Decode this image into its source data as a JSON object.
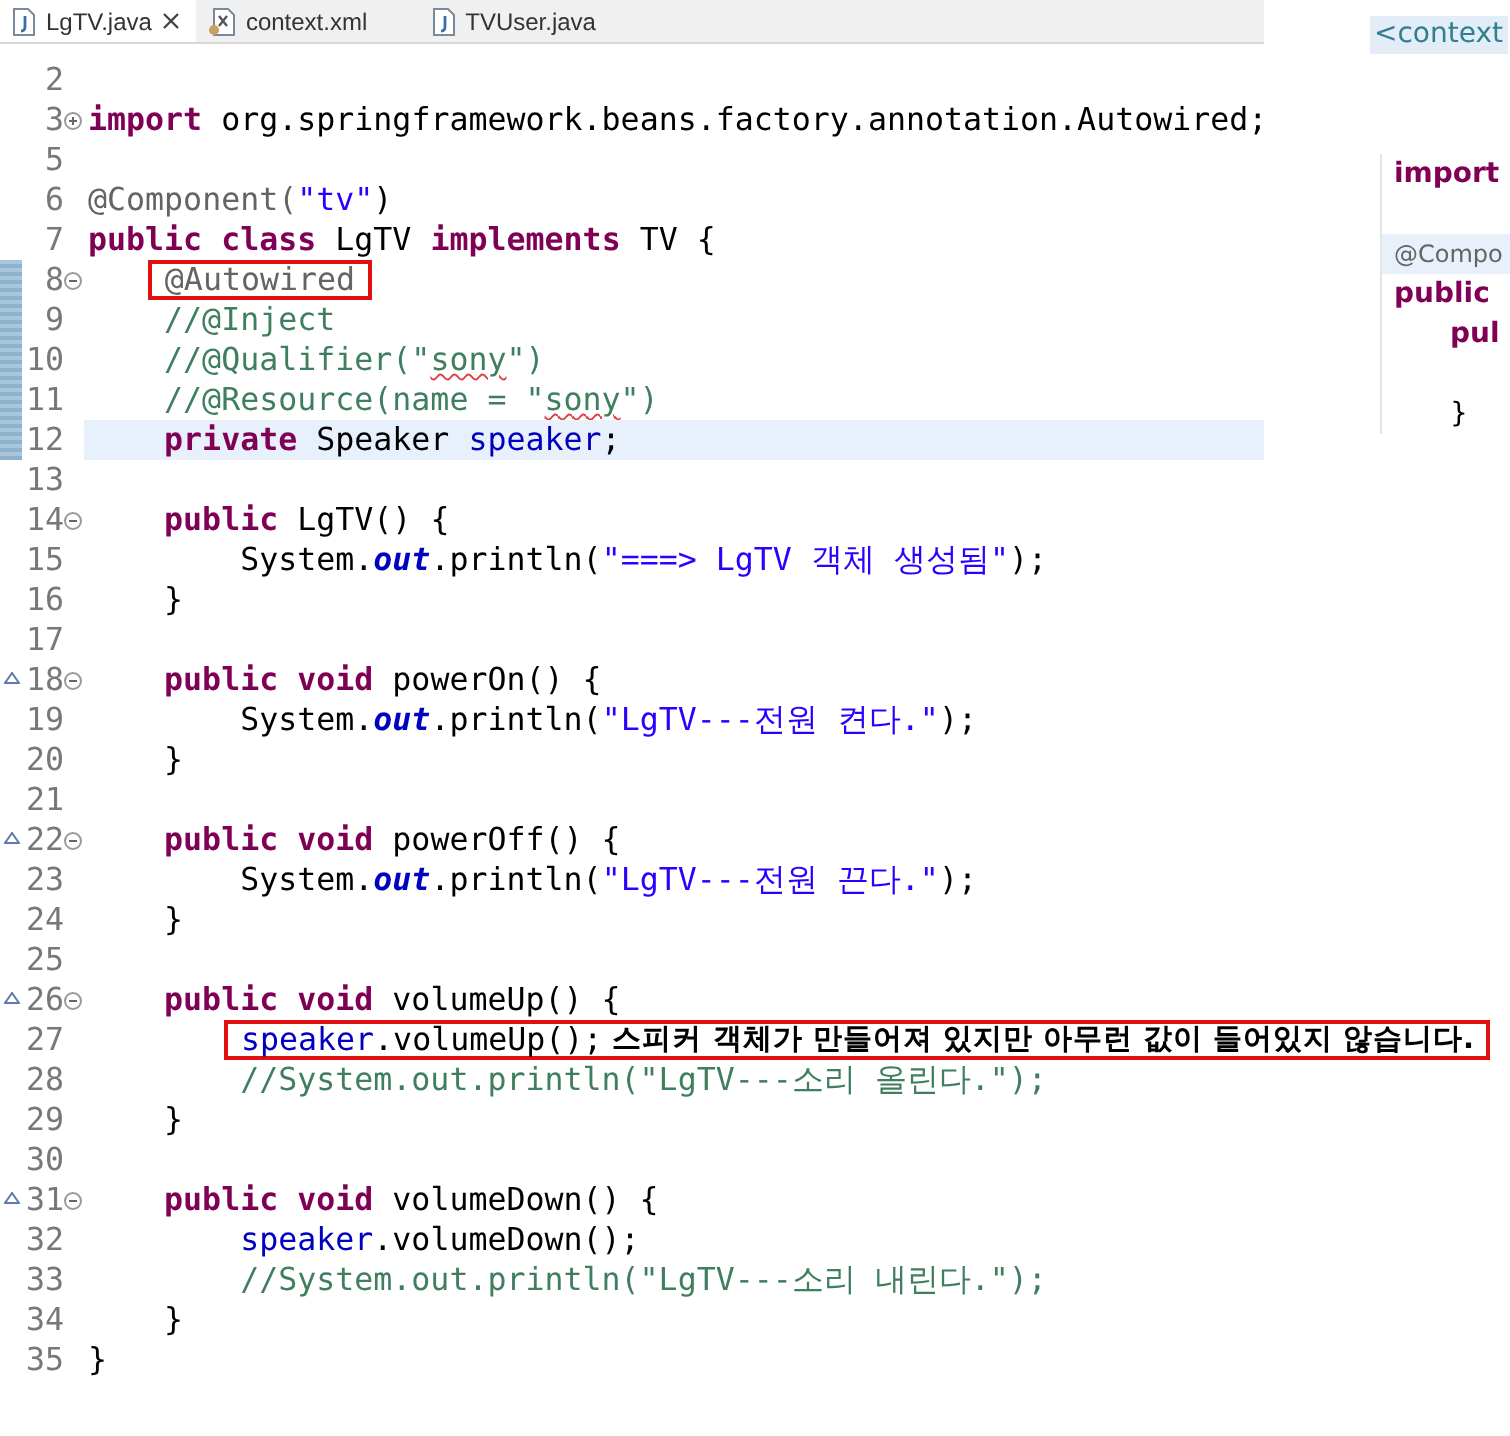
{
  "tabs": [
    {
      "label": "LgTV.java",
      "kind": "java",
      "selected": true
    },
    {
      "label": "context.xml",
      "kind": "xml",
      "selected": false
    },
    {
      "label": "TVUser.java",
      "kind": "java",
      "selected": false
    }
  ],
  "lines": [
    {
      "number": "2"
    },
    {
      "number": "3",
      "folded": true,
      "tokens": [
        {
          "kind": "keyword",
          "text": "import"
        },
        {
          "kind": "plain",
          "text": " org.springframework.beans.factory.annotation.Autowired;"
        }
      ]
    },
    {
      "number": "5"
    },
    {
      "number": "6",
      "tokens": [
        {
          "kind": "annotation",
          "text": "@Component("
        },
        {
          "kind": "string",
          "text": "\"tv\""
        },
        {
          "kind": "plain",
          "text": ")"
        }
      ]
    },
    {
      "number": "7",
      "tokens": [
        {
          "kind": "keyword",
          "text": "public class"
        },
        {
          "kind": "plain",
          "text": " LgTV "
        },
        {
          "kind": "keyword",
          "text": "implements"
        },
        {
          "kind": "plain",
          "text": " TV {"
        }
      ],
      "children": [
        {
          "number": "8",
          "folded": false,
          "changed": true,
          "boxed": true,
          "tokens": [
            {
              "kind": "annotation",
              "text": "@Autowired"
            }
          ]
        },
        {
          "number": "9",
          "changed": true,
          "tokens": [
            {
              "kind": "comment",
              "text": "//@Inject"
            }
          ]
        },
        {
          "number": "10",
          "changed": true,
          "tokens": [
            {
              "kind": "comment",
              "text": "//@Qualifier(\""
            },
            {
              "kind": "comment",
              "text": "sony",
              "misspelled": true
            },
            {
              "kind": "comment",
              "text": "\")"
            }
          ]
        },
        {
          "number": "11",
          "changed": true,
          "tokens": [
            {
              "kind": "comment",
              "text": "//@Resource(name = \""
            },
            {
              "kind": "comment",
              "text": "sony",
              "misspelled": true
            },
            {
              "kind": "comment",
              "text": "\")"
            }
          ]
        },
        {
          "number": "12",
          "changed": true,
          "current": true,
          "tokens": [
            {
              "kind": "keyword",
              "text": "private"
            },
            {
              "kind": "plain",
              "text": " Speaker "
            },
            {
              "kind": "field",
              "text": "speaker"
            },
            {
              "kind": "plain",
              "text": ";"
            }
          ]
        },
        {
          "number": "13"
        },
        {
          "number": "14",
          "folded": false,
          "tokens": [
            {
              "kind": "keyword",
              "text": "public"
            },
            {
              "kind": "plain",
              "text": " LgTV() {"
            }
          ],
          "children": [
            {
              "number": "15",
              "tokens": [
                {
                  "kind": "plain",
                  "text": "System."
                },
                {
                  "kind": "static",
                  "text": "out"
                },
                {
                  "kind": "plain",
                  "text": ".println("
                },
                {
                  "kind": "string",
                  "text": "\"===> LgTV 객체 생성됨\""
                },
                {
                  "kind": "plain",
                  "text": ");"
                }
              ]
            }
          ]
        },
        {
          "number": "16",
          "tokens": [
            {
              "kind": "plain",
              "text": "}"
            }
          ]
        },
        {
          "number": "17"
        },
        {
          "number": "18",
          "folded": false,
          "override": true,
          "tokens": [
            {
              "kind": "keyword",
              "text": "public void"
            },
            {
              "kind": "plain",
              "text": " powerOn() {"
            }
          ],
          "children": [
            {
              "number": "19",
              "tokens": [
                {
                  "kind": "plain",
                  "text": "System."
                },
                {
                  "kind": "static",
                  "text": "out"
                },
                {
                  "kind": "plain",
                  "text": ".println("
                },
                {
                  "kind": "string",
                  "text": "\"LgTV---전원 켠다.\""
                },
                {
                  "kind": "plain",
                  "text": ");"
                }
              ]
            }
          ]
        },
        {
          "number": "20",
          "tokens": [
            {
              "kind": "plain",
              "text": "}"
            }
          ]
        },
        {
          "number": "21"
        },
        {
          "number": "22",
          "folded": false,
          "override": true,
          "tokens": [
            {
              "kind": "keyword",
              "text": "public void"
            },
            {
              "kind": "plain",
              "text": " powerOff() {"
            }
          ],
          "children": [
            {
              "number": "23",
              "tokens": [
                {
                  "kind": "plain",
                  "text": "System."
                },
                {
                  "kind": "static",
                  "text": "out"
                },
                {
                  "kind": "plain",
                  "text": ".println("
                },
                {
                  "kind": "string",
                  "text": "\"LgTV---전원 끈다.\""
                },
                {
                  "kind": "plain",
                  "text": ");"
                }
              ]
            }
          ]
        },
        {
          "number": "24",
          "tokens": [
            {
              "kind": "plain",
              "text": "}"
            }
          ]
        },
        {
          "number": "25"
        },
        {
          "number": "26",
          "folded": false,
          "override": true,
          "tokens": [
            {
              "kind": "keyword",
              "text": "public void"
            },
            {
              "kind": "plain",
              "text": " volumeUp() {"
            }
          ],
          "children": [
            {
              "number": "27",
              "boxed": true,
              "note": "스피커 객체가 만들어져 있지만 아무런 값이 들어있지 않습니다.",
              "tokens": [
                {
                  "kind": "field",
                  "text": "speaker"
                },
                {
                  "kind": "plain",
                  "text": ".volumeUp();"
                }
              ]
            },
            {
              "number": "28",
              "tokens": [
                {
                  "kind": "comment",
                  "text": "//System.out.println(\"LgTV---소리 올린다.\");"
                }
              ]
            }
          ]
        },
        {
          "number": "29",
          "tokens": [
            {
              "kind": "plain",
              "text": "}"
            }
          ]
        },
        {
          "number": "30"
        },
        {
          "number": "31",
          "folded": false,
          "override": true,
          "tokens": [
            {
              "kind": "keyword",
              "text": "public void"
            },
            {
              "kind": "plain",
              "text": " volumeDown() {"
            }
          ],
          "children": [
            {
              "number": "32",
              "tokens": [
                {
                  "kind": "field",
                  "text": "speaker"
                },
                {
                  "kind": "plain",
                  "text": ".volumeDown();"
                }
              ]
            },
            {
              "number": "33",
              "tokens": [
                {
                  "kind": "comment",
                  "text": "//System.out.println(\"LgTV---소리 내린다.\");"
                }
              ]
            }
          ]
        },
        {
          "number": "34",
          "tokens": [
            {
              "kind": "plain",
              "text": "}"
            }
          ]
        }
      ]
    },
    {
      "number": "35",
      "tokens": [
        {
          "kind": "plain",
          "text": "}"
        }
      ]
    }
  ],
  "side_editor": {
    "tag": "<context",
    "lines": [
      {
        "kind": "keyword",
        "text": "import"
      },
      {
        "kind": "blank"
      },
      {
        "kind": "annotation",
        "text": "@Compo",
        "current": true
      },
      {
        "kind": "keyword",
        "text": "public",
        "children": [
          {
            "kind": "keyword",
            "text": "pul"
          },
          {
            "kind": "blank"
          },
          {
            "kind": "plain",
            "text": "}"
          }
        ]
      }
    ]
  }
}
